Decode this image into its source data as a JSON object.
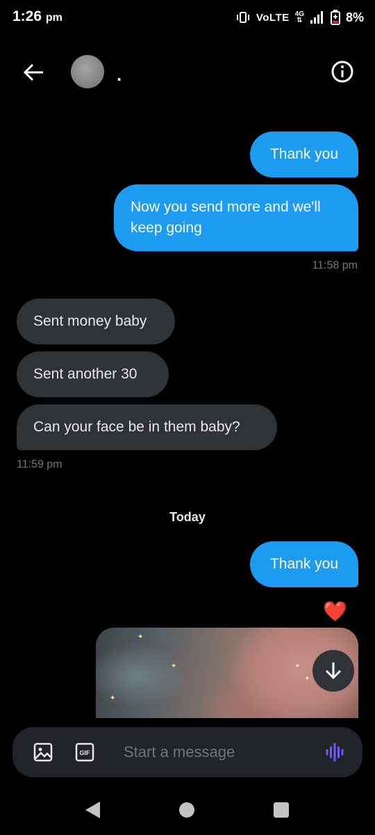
{
  "status_bar": {
    "time": "1:26",
    "period": "pm",
    "volte": "VoLTE",
    "network": "4G",
    "battery": "8%"
  },
  "header": {
    "contact_name": "."
  },
  "messages": {
    "m1": "Thank you",
    "m2": "Now you send more and we'll keep going",
    "time1": "11:58 pm",
    "m3": "Sent money baby",
    "m4": "Sent another 30",
    "m5": "Can your face be in them baby?",
    "time2": "11:59 pm",
    "day_separator": "Today",
    "m6": "Thank you",
    "reaction": "❤️"
  },
  "composer": {
    "placeholder": "Start a message",
    "gif_label": "GIF"
  },
  "colors": {
    "sent_bubble": "#1d9bf0",
    "received_bubble": "#2f3336",
    "background": "#000000",
    "voice_accent": "#7856ff"
  }
}
